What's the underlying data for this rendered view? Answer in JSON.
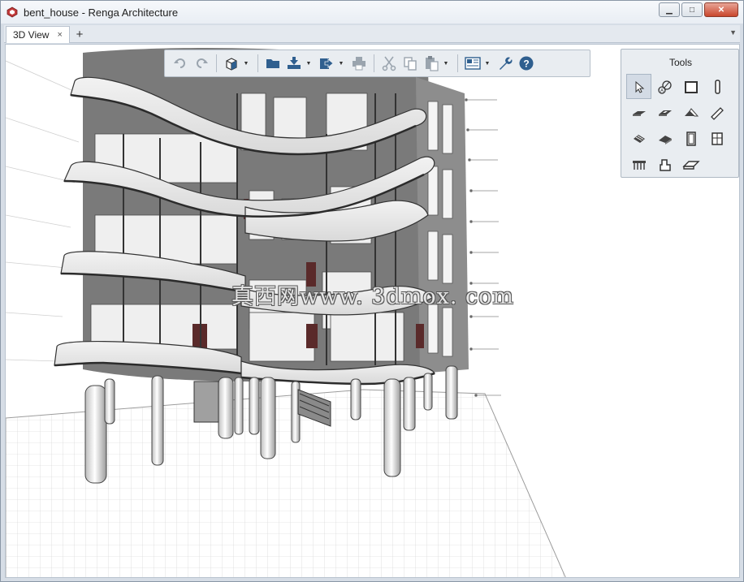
{
  "window": {
    "title": "bent_house - Renga Architecture",
    "controls": {
      "minimize": "▁",
      "maximize": "□",
      "close": "✕"
    }
  },
  "tabs": {
    "items": [
      {
        "label": "3D View",
        "close": "×"
      }
    ],
    "add": "+",
    "menu": "▼"
  },
  "toolbar": {
    "buttons": [
      {
        "name": "undo-icon"
      },
      {
        "name": "redo-icon"
      },
      {
        "name": "view-cube-icon",
        "dropdown": true
      },
      {
        "name": "open-folder-icon"
      },
      {
        "name": "import-icon",
        "dropdown": true
      },
      {
        "name": "export-icon",
        "dropdown": true
      },
      {
        "name": "print-icon"
      },
      {
        "name": "cut-icon"
      },
      {
        "name": "copy-icon"
      },
      {
        "name": "paste-icon",
        "dropdown": true
      },
      {
        "name": "drawings-icon",
        "dropdown": true
      },
      {
        "name": "settings-wrench-icon"
      },
      {
        "name": "help-icon"
      }
    ]
  },
  "tools": {
    "title": "Tools",
    "items": [
      {
        "name": "select-tool-icon"
      },
      {
        "name": "axis-tool-icon"
      },
      {
        "name": "wall-tool-icon"
      },
      {
        "name": "column-tool-icon"
      },
      {
        "name": "floor-tool-icon"
      },
      {
        "name": "opening-tool-icon"
      },
      {
        "name": "roof-tool-icon"
      },
      {
        "name": "beam-tool-icon"
      },
      {
        "name": "stair-tool-icon"
      },
      {
        "name": "ramp-tool-icon"
      },
      {
        "name": "door-tool-icon"
      },
      {
        "name": "window-tool-icon"
      },
      {
        "name": "railing-tool-icon"
      },
      {
        "name": "object-tool-icon"
      },
      {
        "name": "room-tool-icon"
      }
    ]
  },
  "watermark": "真西网www. 3dmox. com",
  "colors": {
    "accent": "#2f5f8f",
    "viewport_bg": "#ffffff",
    "frame": "#d6dde6"
  }
}
